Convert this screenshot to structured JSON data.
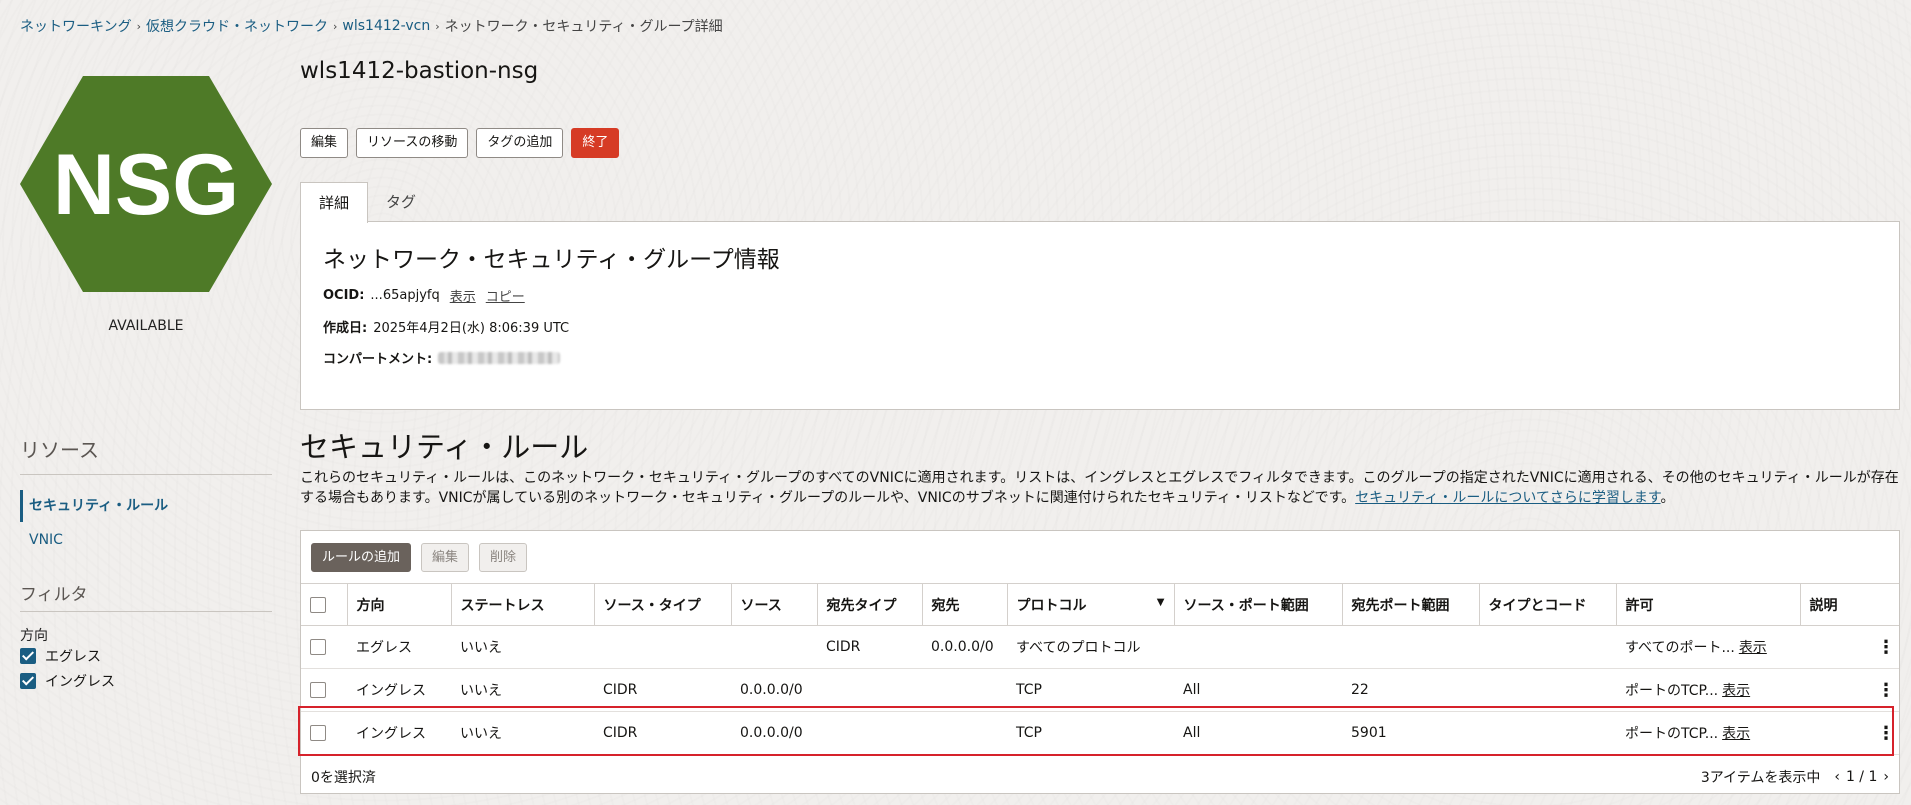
{
  "breadcrumb": {
    "items": [
      "ネットワーキング",
      "仮想クラウド・ネットワーク",
      "wls1412-vcn"
    ],
    "current": "ネットワーク・セキュリティ・グループ詳細"
  },
  "logo": {
    "text": "NSG",
    "color": "#4e7a27"
  },
  "status": "AVAILABLE",
  "page_title": "wls1412-bastion-nsg",
  "actions": {
    "edit": "編集",
    "move": "リソースの移動",
    "add_tags": "タグの追加",
    "terminate": "終了"
  },
  "tabs": {
    "details": "詳細",
    "tags": "タグ"
  },
  "info": {
    "title": "ネットワーク・セキュリティ・グループ情報",
    "ocid_label": "OCID:",
    "ocid_value": "...65apjyfq",
    "show": "表示",
    "copy": "コピー",
    "created_label": "作成日:",
    "created_value": "2025年4月2日(水) 8:06:39 UTC",
    "compartment_label": "コンパートメント:"
  },
  "resources": {
    "title": "リソース",
    "items": [
      "セキュリティ・ルール",
      "VNIC"
    ]
  },
  "filter": {
    "title": "フィルタ",
    "direction_label": "方向",
    "options": [
      "エグレス",
      "イングレス"
    ]
  },
  "security_rules": {
    "title": "セキュリティ・ルール",
    "description": "これらのセキュリティ・ルールは、このネットワーク・セキュリティ・グループのすべてのVNICに適用されます。リストは、イングレスとエグレスでフィルタできます。このグループの指定されたVNICに適用される、その他のセキュリティ・ルールが存在する場合もあります。VNICが属している別のネットワーク・セキュリティ・グループのルールや、VNICのサブネットに関連付けられたセキュリティ・リストなどです。",
    "learn_more": "セキュリティ・ルールについてさらに学習します",
    "learn_more_tail": "。",
    "buttons": {
      "add": "ルールの追加",
      "edit": "編集",
      "delete": "削除"
    },
    "columns": [
      "方向",
      "ステートレス",
      "ソース・タイプ",
      "ソース",
      "宛先タイプ",
      "宛先",
      "プロトコル",
      "ソース・ポート範囲",
      "宛先ポート範囲",
      "タイプとコード",
      "許可",
      "説明"
    ],
    "rows": [
      {
        "direction": "エグレス",
        "stateless": "いいえ",
        "source_type": "",
        "source": "",
        "dest_type": "CIDR",
        "dest": "0.0.0.0/0",
        "protocol": "すべてのプロトコル",
        "src_port": "",
        "dst_port": "",
        "type_code": "",
        "allows": "すべてのポート...",
        "show": "表示"
      },
      {
        "direction": "イングレス",
        "stateless": "いいえ",
        "source_type": "CIDR",
        "source": "0.0.0.0/0",
        "dest_type": "",
        "dest": "",
        "protocol": "TCP",
        "src_port": "All",
        "dst_port": "22",
        "type_code": "",
        "allows": "ポートのTCP...",
        "show": "表示"
      },
      {
        "direction": "イングレス",
        "stateless": "いいえ",
        "source_type": "CIDR",
        "source": "0.0.0.0/0",
        "dest_type": "",
        "dest": "",
        "protocol": "TCP",
        "src_port": "All",
        "dst_port": "5901",
        "type_code": "",
        "allows": "ポートのTCP...",
        "show": "表示"
      }
    ],
    "selected": "0を選択済",
    "showing": "3アイテムを表示中",
    "page": "1 / 1"
  }
}
